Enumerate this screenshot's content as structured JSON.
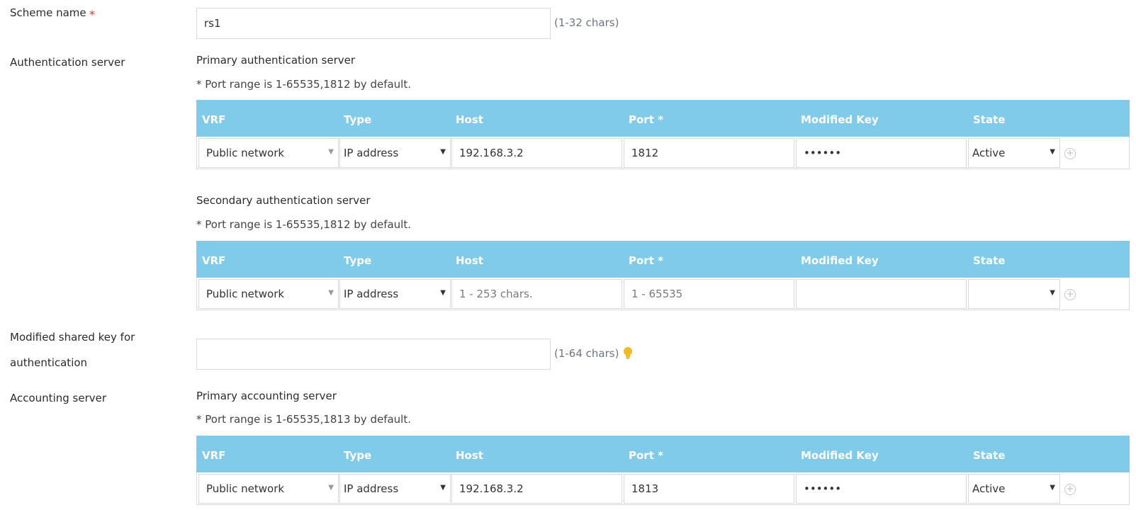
{
  "scheme": {
    "label": "Scheme name",
    "required_mark": "*",
    "value": "rs1",
    "hint": "(1-32 chars)"
  },
  "auth_server": {
    "label": "Authentication server",
    "primary_title": "Primary authentication server",
    "primary_note": "* Port range is 1-65535,1812 by default.",
    "secondary_title": "Secondary authentication server",
    "secondary_note": "* Port range is 1-65535,1812 by default."
  },
  "columns": {
    "vrf": "VRF",
    "type": "Type",
    "host": "Host",
    "port": "Port *",
    "key": "Modified Key",
    "state": "State"
  },
  "primary_auth_row": {
    "vrf": "Public network",
    "type": "IP address",
    "host": "192.168.3.2",
    "port": "1812",
    "key": "••••••",
    "state": "Active"
  },
  "secondary_auth_row": {
    "vrf": "Public network",
    "type": "IP address",
    "host_placeholder": "1 - 253 chars.",
    "port_placeholder": "1 - 65535",
    "key": "",
    "state": ""
  },
  "shared_key": {
    "label_line1": "Modified shared key for",
    "label_line2": "authentication",
    "value": "",
    "hint": "(1-64 chars)"
  },
  "acct_server": {
    "label": "Accounting server",
    "primary_title": "Primary accounting server",
    "primary_note": "* Port range is 1-65535,1813 by default."
  },
  "primary_acct_row": {
    "vrf": "Public network",
    "type": "IP address",
    "host": "192.168.3.2",
    "port": "1813",
    "key": "••••••",
    "state": "Active"
  },
  "icons": {
    "add": "plus-circle-icon",
    "hint": "lightbulb-icon",
    "dropdown": "caret-down-icon"
  },
  "colors": {
    "header_bg": "#80cbea",
    "required": "#e03030",
    "bulb": "#f5b921"
  }
}
